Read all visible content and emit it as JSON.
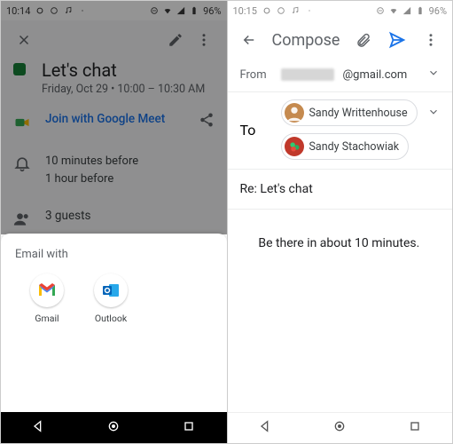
{
  "left": {
    "status": {
      "time": "10:14",
      "battery": "96%"
    },
    "toolbar": {
      "close": "close-icon",
      "edit": "pencil-icon",
      "more": "more-vert-icon"
    },
    "event": {
      "title": "Let's chat",
      "datetime": "Friday, Oct 29  •  10:00 – 10:30 AM",
      "color": "#188038",
      "join_label": "Join with Google Meet",
      "reminders": [
        "10 minutes before",
        "1 hour before"
      ],
      "guests_label": "3 guests"
    },
    "share_sheet": {
      "title": "Email with",
      "apps": [
        {
          "name": "Gmail",
          "icon": "gmail-icon"
        },
        {
          "name": "Outlook",
          "icon": "outlook-icon"
        }
      ]
    }
  },
  "right": {
    "status": {
      "time": "10:15",
      "battery": "96%"
    },
    "compose": {
      "title": "Compose",
      "from_label": "From",
      "from_domain": "@gmail.com",
      "to_label": "To",
      "recipients": [
        {
          "name": "Sandy Writtenhouse",
          "avatar_bg": "#c58a4f"
        },
        {
          "name": "Sandy Stachowiak",
          "avatar_bg": "#c0392b"
        }
      ],
      "subject": "Re: Let's chat",
      "body": "Be there in about 10 minutes."
    }
  }
}
